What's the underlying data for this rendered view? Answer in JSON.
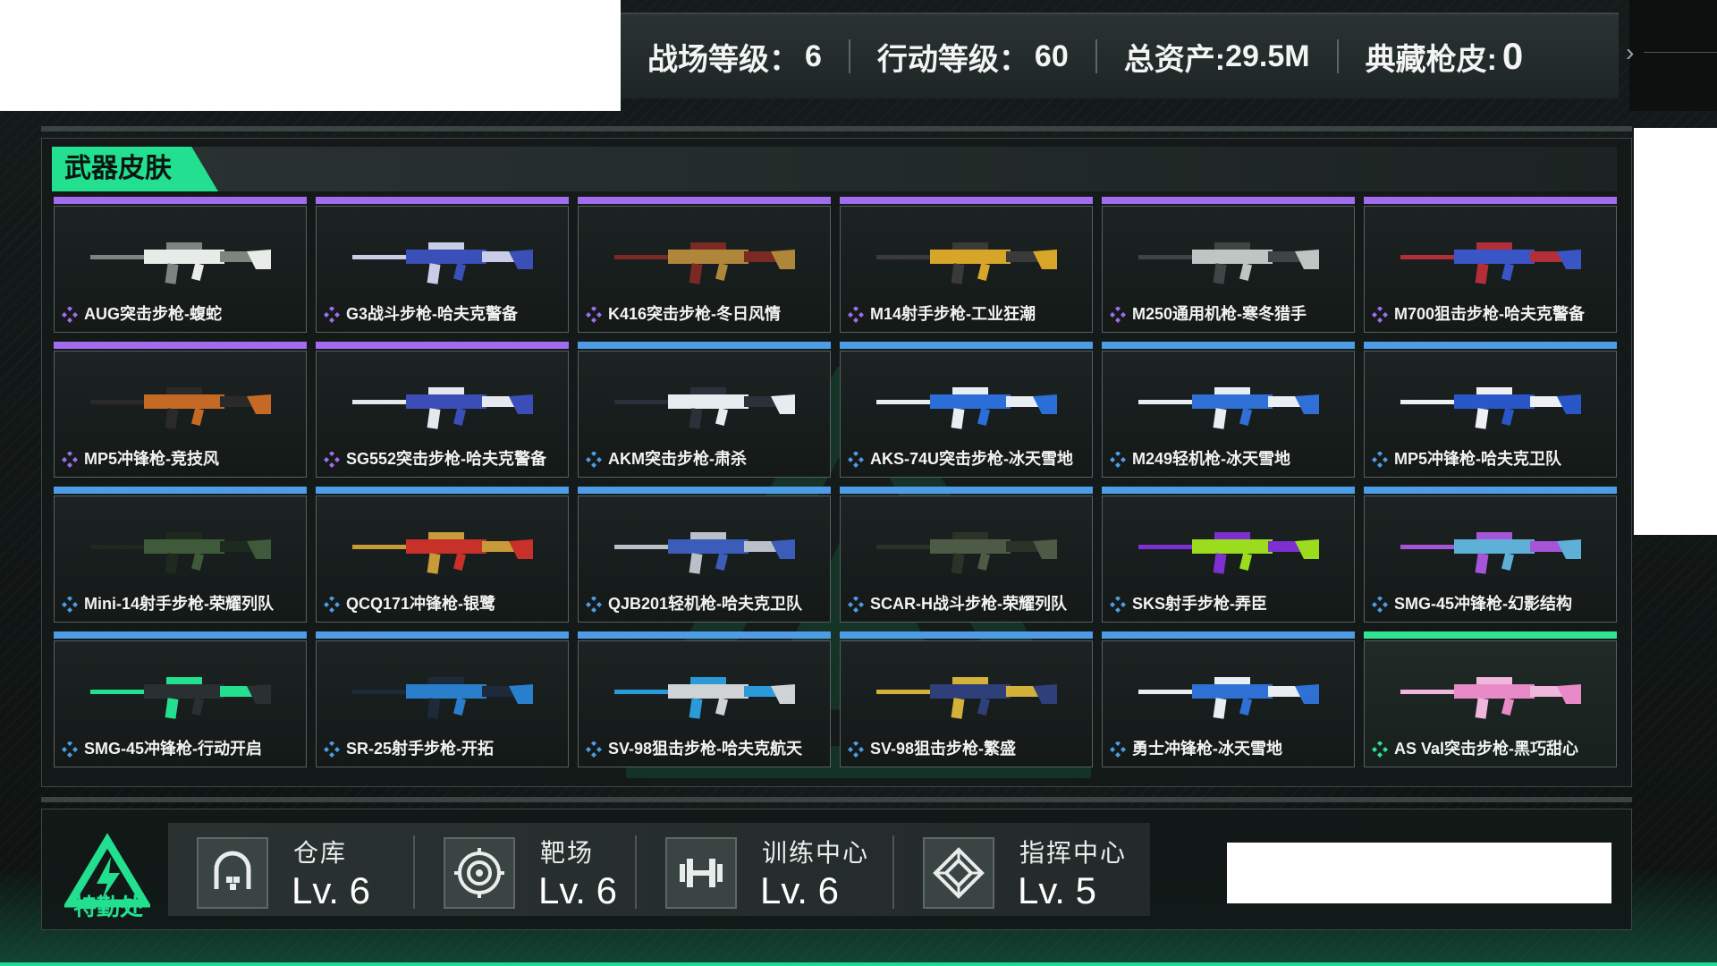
{
  "stats": {
    "battlefield_level_label": "战场等级：",
    "battlefield_level_value": "6",
    "operation_level_label": "行动等级：",
    "operation_level_value": "60",
    "total_assets_label": "总资产:",
    "total_assets_value": "29.5M",
    "collection_skins_label": "典藏枪皮:",
    "collection_skins_value": "0"
  },
  "panel": {
    "title": "武器皮肤"
  },
  "skins": [
    {
      "name": "AUG突击步枪-蝮蛇",
      "rarity": "purple"
    },
    {
      "name": "G3战斗步枪-哈夫克警备",
      "rarity": "purple"
    },
    {
      "name": "K416突击步枪-冬日风情",
      "rarity": "purple"
    },
    {
      "name": "M14射手步枪-工业狂潮",
      "rarity": "purple"
    },
    {
      "name": "M250通用机枪-寒冬猎手",
      "rarity": "purple"
    },
    {
      "name": "M700狙击步枪-哈夫克警备",
      "rarity": "purple"
    },
    {
      "name": "MP5冲锋枪-竞技风",
      "rarity": "purple"
    },
    {
      "name": "SG552突击步枪-哈夫克警备",
      "rarity": "purple"
    },
    {
      "name": "AKM突击步枪-肃杀",
      "rarity": "blue"
    },
    {
      "name": "AKS-74U突击步枪-冰天雪地",
      "rarity": "blue"
    },
    {
      "name": "M249轻机枪-冰天雪地",
      "rarity": "blue"
    },
    {
      "name": "MP5冲锋枪-哈夫克卫队",
      "rarity": "blue"
    },
    {
      "name": "Mini-14射手步枪-荣耀列队",
      "rarity": "blue"
    },
    {
      "name": "QCQ171冲锋枪-银鹭",
      "rarity": "blue"
    },
    {
      "name": "QJB201轻机枪-哈夫克卫队",
      "rarity": "blue"
    },
    {
      "name": "SCAR-H战斗步枪-荣耀列队",
      "rarity": "blue"
    },
    {
      "name": "SKS射手步枪-弄臣",
      "rarity": "blue"
    },
    {
      "name": "SMG-45冲锋枪-幻影结构",
      "rarity": "blue"
    },
    {
      "name": "SMG-45冲锋枪-行动开启",
      "rarity": "blue"
    },
    {
      "name": "SR-25射手步枪-开拓",
      "rarity": "blue"
    },
    {
      "name": "SV-98狙击步枪-哈夫克航天",
      "rarity": "blue"
    },
    {
      "name": "SV-98狙击步枪-繁盛",
      "rarity": "blue"
    },
    {
      "name": "勇士冲锋枪-冰天雪地",
      "rarity": "blue"
    },
    {
      "name": "AS Val突击步枪-黑巧甜心",
      "rarity": "green"
    }
  ],
  "rarity_colors": {
    "purple": "#a26cf0",
    "blue": "#4e9be6",
    "green": "#2fe392"
  },
  "gun_palettes": [
    [
      "#e8ece9",
      "#7c8580"
    ],
    [
      "#3a4fb8",
      "#c9cde8"
    ],
    [
      "#b0863a",
      "#7a2a22"
    ],
    [
      "#d7a628",
      "#3a3a3a"
    ],
    [
      "#bfc5c3",
      "#3f4544"
    ],
    [
      "#3a55c6",
      "#b22f3a"
    ],
    [
      "#c56a24",
      "#2a2a2a"
    ],
    [
      "#3b4eb7",
      "#e6e8f0"
    ],
    [
      "#e6ecef",
      "#2b313a"
    ],
    [
      "#2b6ed8",
      "#e8eef2"
    ],
    [
      "#2f6fd6",
      "#e8eef3"
    ],
    [
      "#2a57c8",
      "#eef0f3"
    ],
    [
      "#3f5a3a",
      "#1f2a1f"
    ],
    [
      "#c8302a",
      "#c89a3a"
    ],
    [
      "#3b5db9",
      "#b9c0c9"
    ],
    [
      "#4d5a45",
      "#2b3228"
    ],
    [
      "#9bdc1f",
      "#7d2fd0"
    ],
    [
      "#5fb0d6",
      "#a455d8"
    ],
    [
      "#2a2f31",
      "#22e08f"
    ],
    [
      "#2a7fcc",
      "#1c2a3a"
    ],
    [
      "#d0d3d6",
      "#2a9ad8"
    ],
    [
      "#2f3f7a",
      "#d4b23a"
    ],
    [
      "#2f70d4",
      "#e9eef3"
    ],
    [
      "#e889c8",
      "#f0b6dc"
    ]
  ],
  "footer": {
    "logo_text": "特勤处",
    "facilities": [
      {
        "name": "仓库",
        "level": "Lv. 6",
        "icon": "warehouse-icon"
      },
      {
        "name": "靶场",
        "level": "Lv. 6",
        "icon": "target-icon"
      },
      {
        "name": "训练中心",
        "level": "Lv. 6",
        "icon": "dumbbell-icon"
      },
      {
        "name": "指挥中心",
        "level": "Lv. 5",
        "icon": "command-icon"
      }
    ]
  }
}
